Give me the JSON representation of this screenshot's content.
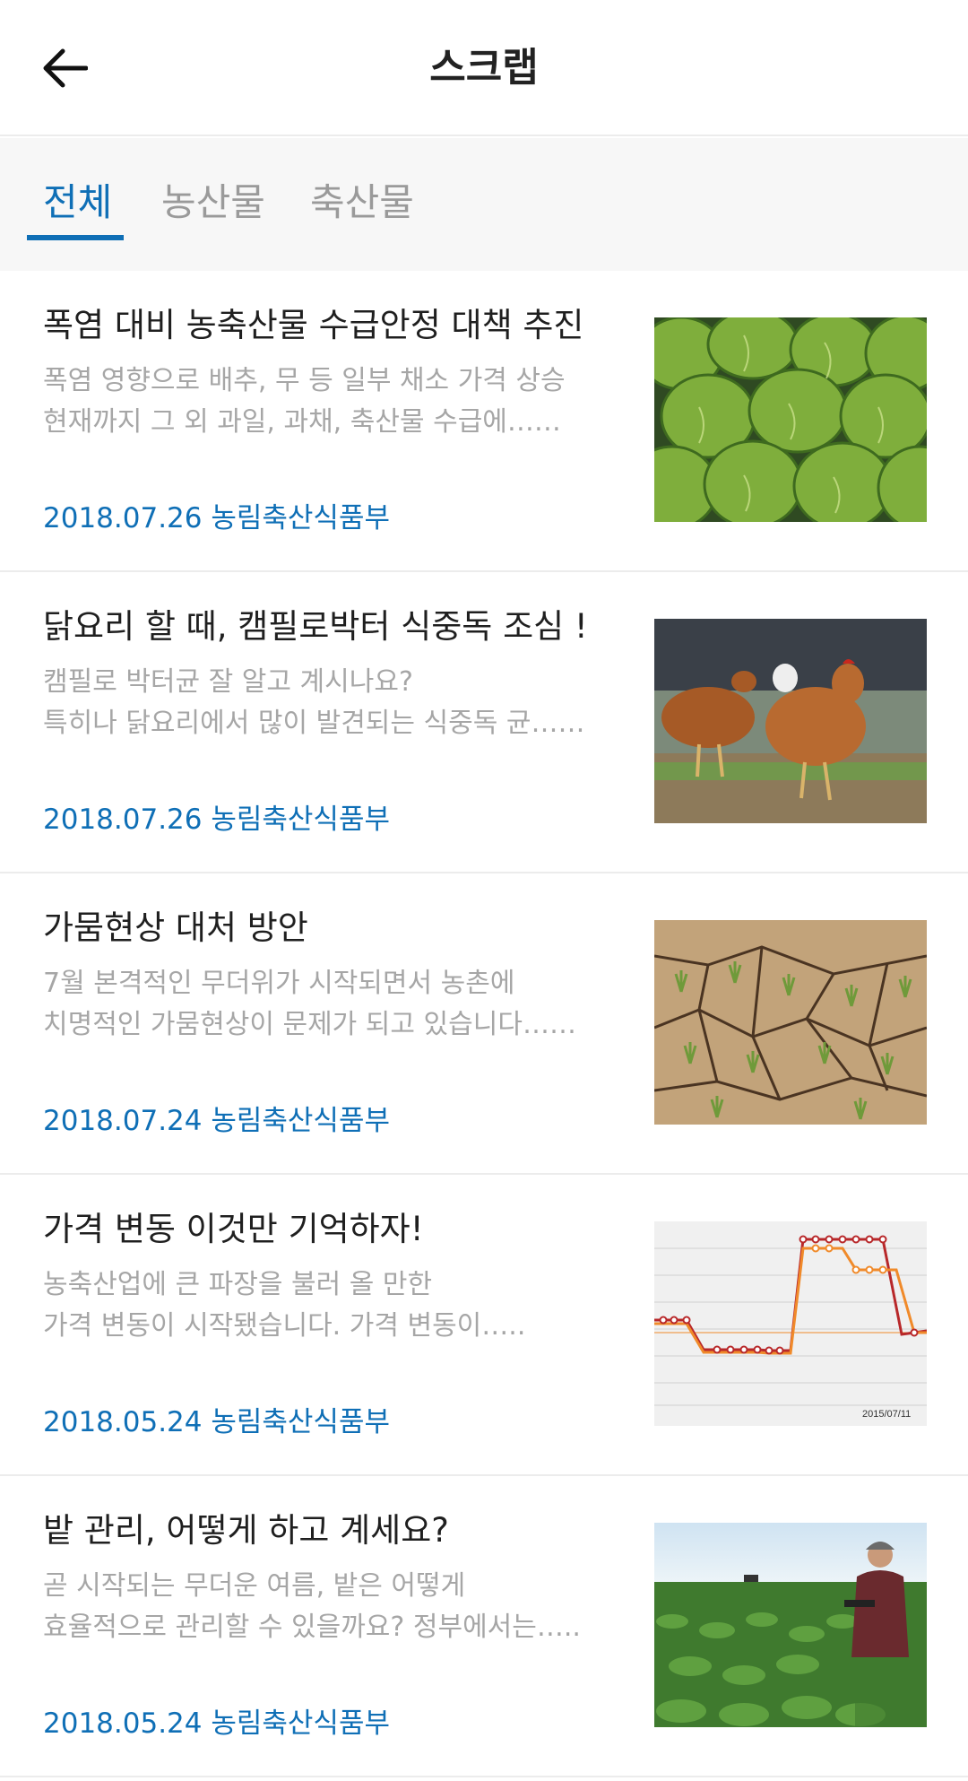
{
  "header": {
    "title": "스크랩",
    "back_icon": "arrow-left-icon"
  },
  "tabs": [
    {
      "label": "전체",
      "active": true
    },
    {
      "label": "농산물",
      "active": false
    },
    {
      "label": "축산물",
      "active": false
    }
  ],
  "theme": {
    "accent": "#0f6fb6",
    "divider": "#ececec",
    "summary_text": "#a6a6a6"
  },
  "articles": [
    {
      "title": "폭염 대비 농축산물 수급안정 대책 추진",
      "summary": [
        "폭염 영향으로 배추, 무 등 일부 채소 가격 상승",
        "현재까지 그 외 과일, 과채, 축산물 수급에……"
      ],
      "date": "2018.07.26",
      "source": "농림축산식품부",
      "meta": "2018.07.26 농림축산식품부",
      "thumbnail": "cabbage-photo"
    },
    {
      "title": "닭요리 할 때, 캠필로박터 식중독 조심 !",
      "summary": [
        "캠필로 박터균 잘 알고 계시나요?",
        "특히나 닭요리에서 많이 발견되는 식중독 균……"
      ],
      "date": "2018.07.26",
      "source": "농림축산식품부",
      "meta": "2018.07.26 농림축산식품부",
      "thumbnail": "chicken-photo"
    },
    {
      "title": "가뭄현상 대처 방안",
      "summary": [
        "7월 본격적인 무더위가 시작되면서 농촌에",
        "치명적인 가뭄현상이 문제가 되고 있습니다……"
      ],
      "date": "2018.07.24",
      "source": "농림축산식품부",
      "meta": "2018.07.24 농림축산식품부",
      "thumbnail": "drought-field-photo"
    },
    {
      "title": "가격 변동 이것만 기억하자!",
      "summary": [
        "농축산업에 큰 파장을 불러 올 만한",
        "가격 변동이 시작됐습니다. 가격 변동이….."
      ],
      "date": "2018.05.24",
      "source": "농림축산식품부",
      "meta": "2018.05.24 농림축산식품부",
      "thumbnail": "price-chart-image",
      "thumbnail_label": "2015/07/11"
    },
    {
      "title": "밭 관리, 어떻게 하고 계세요?",
      "summary": [
        "곧 시작되는 무더운 여름, 밭은 어떻게",
        "효율적으로 관리할 수 있을까요? 정부에서는….."
      ],
      "date": "2018.05.24",
      "source": "농림축산식품부",
      "meta": "2018.05.24 농림축산식품부",
      "thumbnail": "farmer-field-photo"
    }
  ]
}
